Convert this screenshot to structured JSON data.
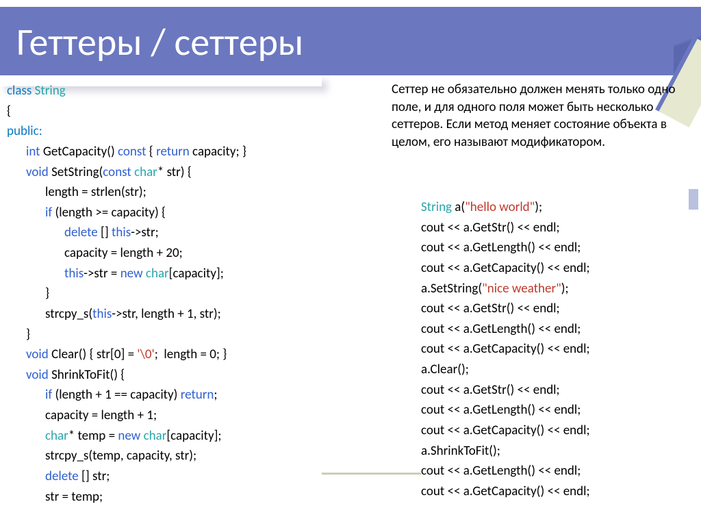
{
  "title": "Геттеры / сеттеры",
  "left": {
    "l01a": "class",
    "l01b": " String",
    "l02": "{",
    "l03": "public:",
    "l04a": "int",
    "l04b": " GetCapacity() ",
    "l04c": "const",
    "l04d": " { ",
    "l04e": "return",
    "l04f": " capacity; }",
    "l05a": "void",
    "l05b": " SetString(",
    "l05c": "const",
    "l05d": " ",
    "l05e": "char",
    "l05f": "* str) {",
    "l06": "length = strlen(str);",
    "l07a": "if",
    "l07b": " (length >= capacity) {",
    "l08a": "delete",
    "l08b": " [] ",
    "l08c": "this",
    "l08d": "->str;",
    "l09": "capacity = length + 20;",
    "l10a": "this",
    "l10b": "->str = ",
    "l10c": "new",
    "l10d": " ",
    "l10e": "char",
    "l10f": "[capacity];",
    "l11": "}",
    "l12a": "strcpy_s(",
    "l12b": "this",
    "l12c": "->str, length + 1, str);",
    "l13": "}",
    "l14a": "void",
    "l14b": " Clear() { str[0] = ",
    "l14c": "'\\0'",
    "l14d": ";  length = 0; }",
    "l15a": "void",
    "l15b": " ShrinkToFit() {",
    "l16a": "if",
    "l16b": " (length + 1 == capacity) ",
    "l16c": "return",
    "l16d": ";",
    "l17": "capacity = length + 1;",
    "l18a": "char",
    "l18b": "* temp = ",
    "l18c": "new",
    "l18d": " ",
    "l18e": "char",
    "l18f": "[capacity];",
    "l19": "strcpy_s(temp, capacity, str);",
    "l20a": "delete",
    "l20b": " [] str;",
    "l21": "str = temp;"
  },
  "right_paragraph": "Сеттер не обязательно должен менять только одно поле, и для одного поля может быть несколько сеттеров. Если метод меняет состояние объекта в целом, его называют модификатором.",
  "right": {
    "r01a": "String",
    "r01b": " a(",
    "r01c": "\"hello world\"",
    "r01d": ");",
    "r02": "cout << a.GetStr() << endl;",
    "r03": "cout << a.GetLength() << endl;",
    "r04": "cout << a.GetCapacity() << endl;",
    "r05a": "a.SetString(",
    "r05b": "\"nice weather\"",
    "r05c": ");",
    "r06": "cout << a.GetStr() << endl;",
    "r07": "cout << a.GetLength() << endl;",
    "r08": "cout << a.GetCapacity() << endl;",
    "r09": "a.Clear();",
    "r10": "cout << a.GetStr() << endl;",
    "r11": "cout << a.GetLength() << endl;",
    "r12": "cout << a.GetCapacity() << endl;",
    "r13": "a.ShrinkToFit();",
    "r14": "cout << a.GetLength() << endl;",
    "r15": "cout << a.GetCapacity() << endl;"
  }
}
